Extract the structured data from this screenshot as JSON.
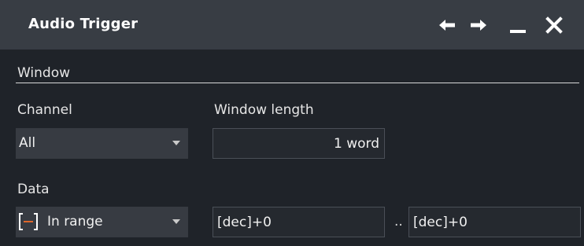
{
  "dialog": {
    "title": "Audio Trigger",
    "buttons": {
      "back": "back-arrow-icon",
      "forward": "forward-arrow-icon",
      "minimize": "minimize-icon",
      "close": "close-icon"
    }
  },
  "window_section": {
    "label": "Window"
  },
  "channel": {
    "label": "Channel",
    "value": "All"
  },
  "window_length": {
    "label": "Window length",
    "value": "1 word"
  },
  "data": {
    "label": "Data",
    "condition": "In range",
    "condition_icon": "in-range-icon",
    "min_value": "[dec]+0",
    "separator": "..",
    "max_value": "[dec]+0"
  },
  "colors": {
    "background": "#1f2329",
    "titlebar": "#383d44",
    "accent": "#e0662b"
  }
}
